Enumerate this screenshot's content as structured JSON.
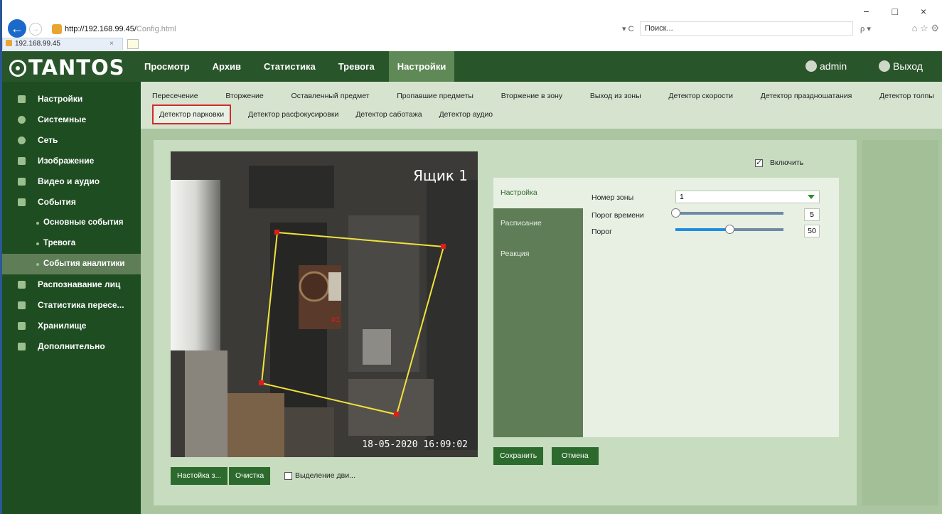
{
  "browser": {
    "url_host": "http://192.168.99.45/",
    "url_path": "Config.html",
    "address_controls": "▾ C",
    "search_placeholder": "Поиск...",
    "search_controls": "ρ ▾",
    "window_buttons": "− □ ×",
    "toolbar_icons": "⌂ ☆ ⚙",
    "tab_title": "192.168.99.45",
    "tab_close": "×"
  },
  "app": {
    "logo": "TANTOS",
    "menu": [
      "Просмотр",
      "Архив",
      "Статистика",
      "Тревога",
      "Настройки"
    ],
    "active_menu_index": 4,
    "user": "admin",
    "logout": "Выход"
  },
  "sidebar": {
    "items": [
      {
        "label": "Настройки",
        "icon": "settings-icon"
      },
      {
        "label": "Системные",
        "icon": "info-icon"
      },
      {
        "label": "Сеть",
        "icon": "globe-icon"
      },
      {
        "label": "Изображение",
        "icon": "image-icon"
      },
      {
        "label": "Видео и аудио",
        "icon": "video-icon"
      },
      {
        "label": "События",
        "icon": "events-icon"
      },
      {
        "label": "Основные события",
        "sub": true
      },
      {
        "label": "Тревога",
        "sub": true
      },
      {
        "label": "События аналитики",
        "sub": true,
        "active": true
      },
      {
        "label": "Распознавание лиц",
        "icon": "face-icon"
      },
      {
        "label": "Статистика пересе...",
        "icon": "chart-icon"
      },
      {
        "label": "Хранилище",
        "icon": "storage-icon"
      },
      {
        "label": "Дополнительно",
        "icon": "tools-icon"
      }
    ]
  },
  "subtabs": {
    "row1": [
      "Пересечение",
      "Вторжение",
      "Оставленный предмет",
      "Пропавшие предметы",
      "Вторжение в зону",
      "Выход из зоны",
      "Детектор скорости",
      "Детектор праздношатания",
      "Детектор толпы"
    ],
    "row2": [
      "Детектор парковки",
      "Детектор расфокусировки",
      "Детектор саботажа",
      "Детектор аудио"
    ],
    "active": "Детектор парковки"
  },
  "video": {
    "camera_name": "Ящик 1",
    "timestamp": "18-05-2020 16:09:02",
    "zone_label": "#1"
  },
  "video_buttons": {
    "setup": "Настойка з...",
    "clear": "Очистка",
    "motion_highlight": "Выделение дви..."
  },
  "enable": {
    "label": "Включить",
    "checked": true
  },
  "config_tabs": [
    "Настройка",
    "Расписание",
    "Реакция"
  ],
  "config_active_tab": 0,
  "config": {
    "zone_label": "Номер зоны",
    "zone_value": "1",
    "time_threshold_label": "Порог времени",
    "time_threshold_value": "5",
    "time_threshold_fraction": 0.0,
    "threshold_label": "Порог",
    "threshold_value": "50",
    "threshold_fraction": 0.5
  },
  "actions": {
    "save": "Сохранить",
    "cancel": "Отмена"
  }
}
